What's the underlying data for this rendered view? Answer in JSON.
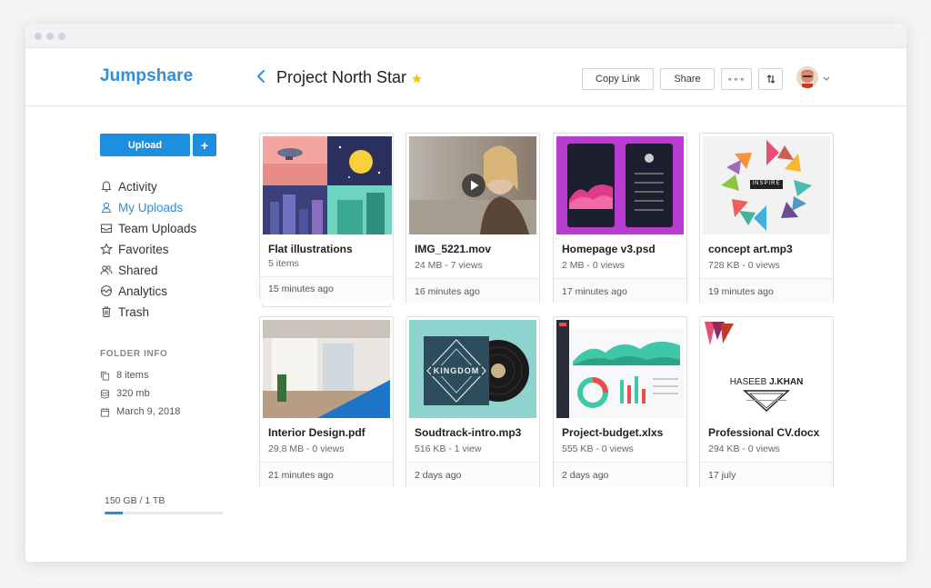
{
  "app": {
    "logo": "Jumpshare"
  },
  "header": {
    "project_title": "Project North Star",
    "copy_link_label": "Copy Link",
    "share_label": "Share",
    "more_label": "∘∘∘",
    "colors": {
      "accent": "#1d8fe1",
      "star": "#f5c518"
    }
  },
  "sidebar": {
    "upload_label": "Upload",
    "plus_label": "+",
    "nav": [
      {
        "label": "Activity",
        "icon": "bell-icon"
      },
      {
        "label": "My Uploads",
        "icon": "user-icon",
        "active": true
      },
      {
        "label": "Team Uploads",
        "icon": "inbox-icon"
      },
      {
        "label": "Favorites",
        "icon": "star-icon"
      },
      {
        "label": "Shared",
        "icon": "users-icon"
      },
      {
        "label": "Analytics",
        "icon": "analytics-icon"
      },
      {
        "label": "Trash",
        "icon": "trash-icon"
      }
    ],
    "folder_info": {
      "heading": "FOLDER INFO",
      "items": [
        {
          "label": "8 items",
          "icon": "copy-icon"
        },
        {
          "label": "320 mb",
          "icon": "database-icon"
        },
        {
          "label": "March 9, 2018",
          "icon": "calendar-icon"
        }
      ]
    },
    "storage": {
      "label": "150 GB / 1 TB",
      "used_fraction": 0.15
    }
  },
  "files": [
    {
      "name": "Flat illustrations",
      "meta": "5 items",
      "time": "15 minutes ago",
      "type": "folder"
    },
    {
      "name": "IMG_5221.mov",
      "meta": "24 MB - 7 views",
      "time": "16 minutes ago",
      "type": "video"
    },
    {
      "name": "Homepage v3.psd",
      "meta": "2 MB - 0 views",
      "time": "17 minutes ago",
      "type": "psd"
    },
    {
      "name": "concept art.mp3",
      "meta": "728 KB - 0 views",
      "time": "19 minutes ago",
      "type": "audio",
      "thumb_text": "INSPIRE"
    },
    {
      "name": "Interior Design.pdf",
      "meta": "29,8 MB - 0 views",
      "time": "21 minutes ago",
      "type": "pdf"
    },
    {
      "name": "Soudtrack-intro.mp3",
      "meta": "516 KB - 1 view",
      "time": "2 days ago",
      "type": "audio",
      "thumb_text": "KINGDOM"
    },
    {
      "name": "Project-budget.xlxs",
      "meta": "555 KB - 0 views",
      "time": "2 days ago",
      "type": "xlsx"
    },
    {
      "name": "Professional CV.docx",
      "meta": "294 KB - 0 views",
      "time": "17 july",
      "type": "docx",
      "thumb_text_a": "HASEEB",
      "thumb_text_b": "J.KHAN"
    }
  ]
}
